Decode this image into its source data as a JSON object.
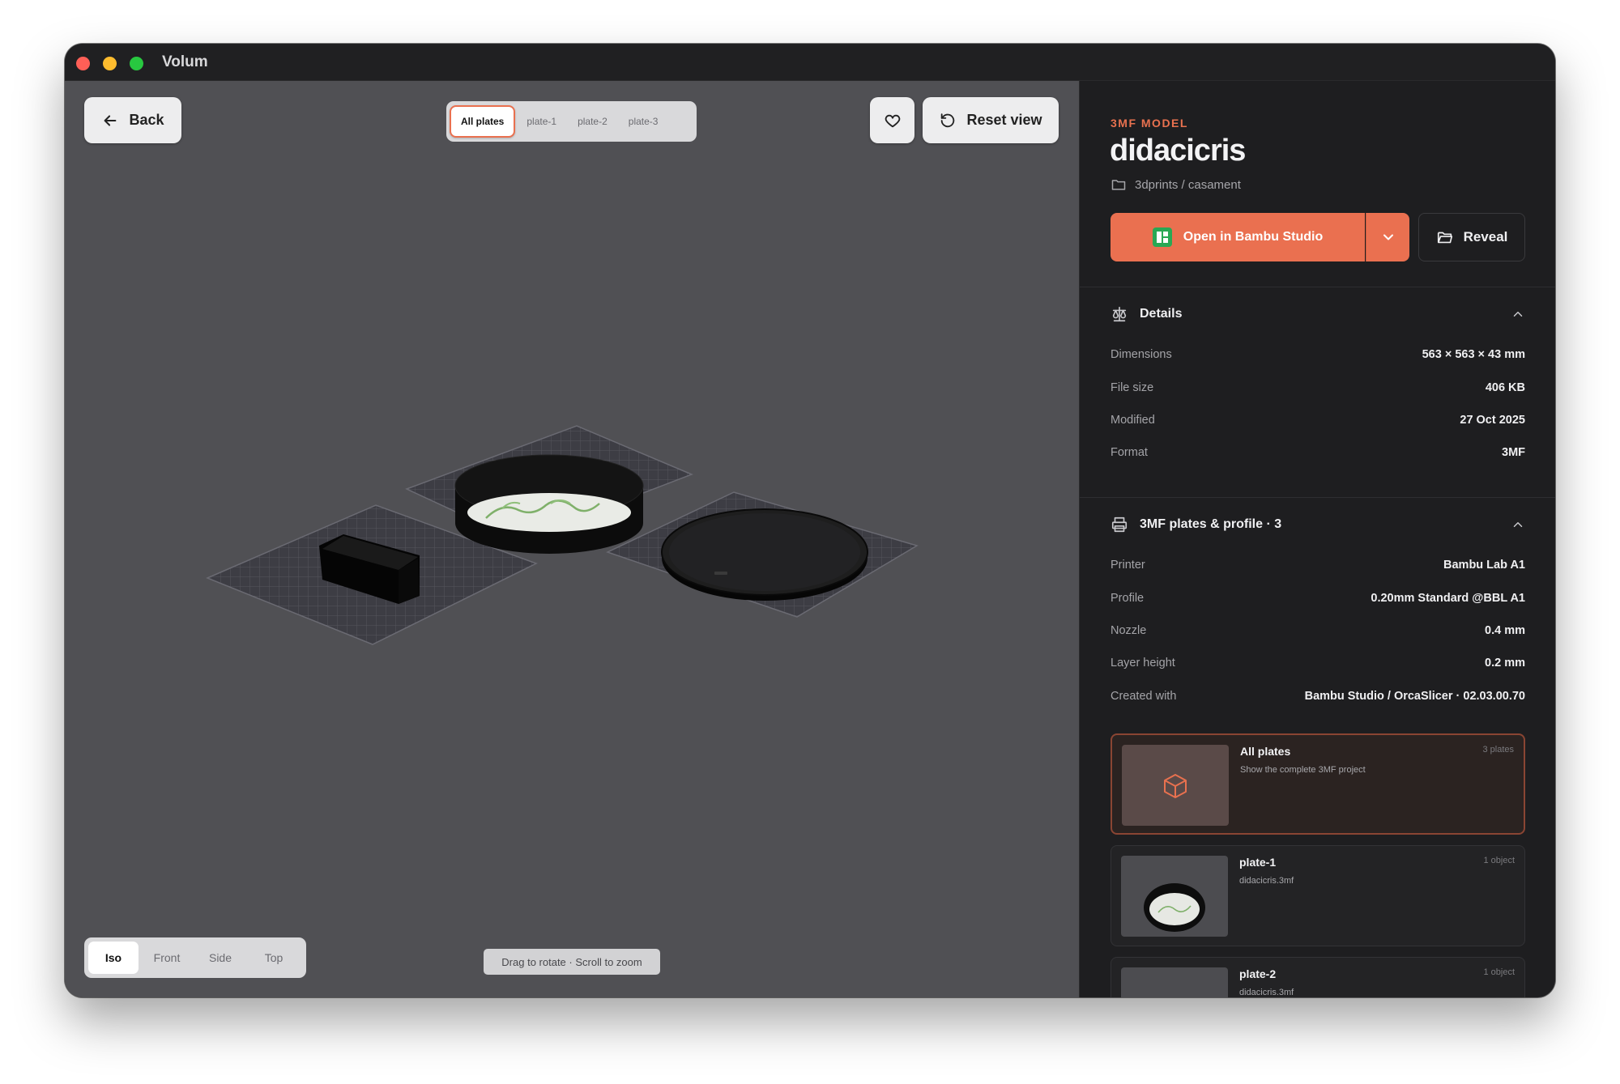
{
  "app": {
    "title": "Volum"
  },
  "viewport": {
    "back_label": "Back",
    "reset_label": "Reset view",
    "plate_tabs": [
      "All plates",
      "plate-1",
      "plate-2",
      "plate-3"
    ],
    "active_plate_tab": "All plates",
    "view_tabs": [
      "Iso",
      "Front",
      "Side",
      "Top"
    ],
    "active_view_tab": "Iso",
    "hint": "Drag to rotate · Scroll to zoom"
  },
  "model": {
    "kind": "3MF MODEL",
    "name": "didacicris",
    "path": "3dprints / casament",
    "open_label": "Open in Bambu Studio",
    "reveal_label": "Reveal"
  },
  "details": {
    "title": "Details",
    "rows": [
      {
        "key": "Dimensions",
        "value": "563 × 563 × 43 mm"
      },
      {
        "key": "File size",
        "value": "406 KB"
      },
      {
        "key": "Modified",
        "value": "27 Oct 2025"
      },
      {
        "key": "Format",
        "value": "3MF"
      }
    ]
  },
  "plates_profile": {
    "title": "3MF plates & profile · 3",
    "rows": [
      {
        "key": "Printer",
        "value": "Bambu Lab A1"
      },
      {
        "key": "Profile",
        "value": "0.20mm Standard @BBL A1"
      },
      {
        "key": "Nozzle",
        "value": "0.4 mm"
      },
      {
        "key": "Layer height",
        "value": "0.2 mm"
      },
      {
        "key": "Created with",
        "value": "Bambu Studio / OrcaSlicer · 02.03.00.70"
      }
    ],
    "cards": [
      {
        "title": "All plates",
        "subtitle": "Show the complete 3MF project",
        "count": "3 plates"
      },
      {
        "title": "plate-1",
        "subtitle": "didacicris.3mf",
        "count": "1 object"
      },
      {
        "title": "plate-2",
        "subtitle": "didacicris.3mf",
        "count": "1 object"
      }
    ]
  },
  "colors": {
    "accent": "#ea7050",
    "viewport_bg": "#505054",
    "sidebar_bg": "#1e1e20"
  }
}
